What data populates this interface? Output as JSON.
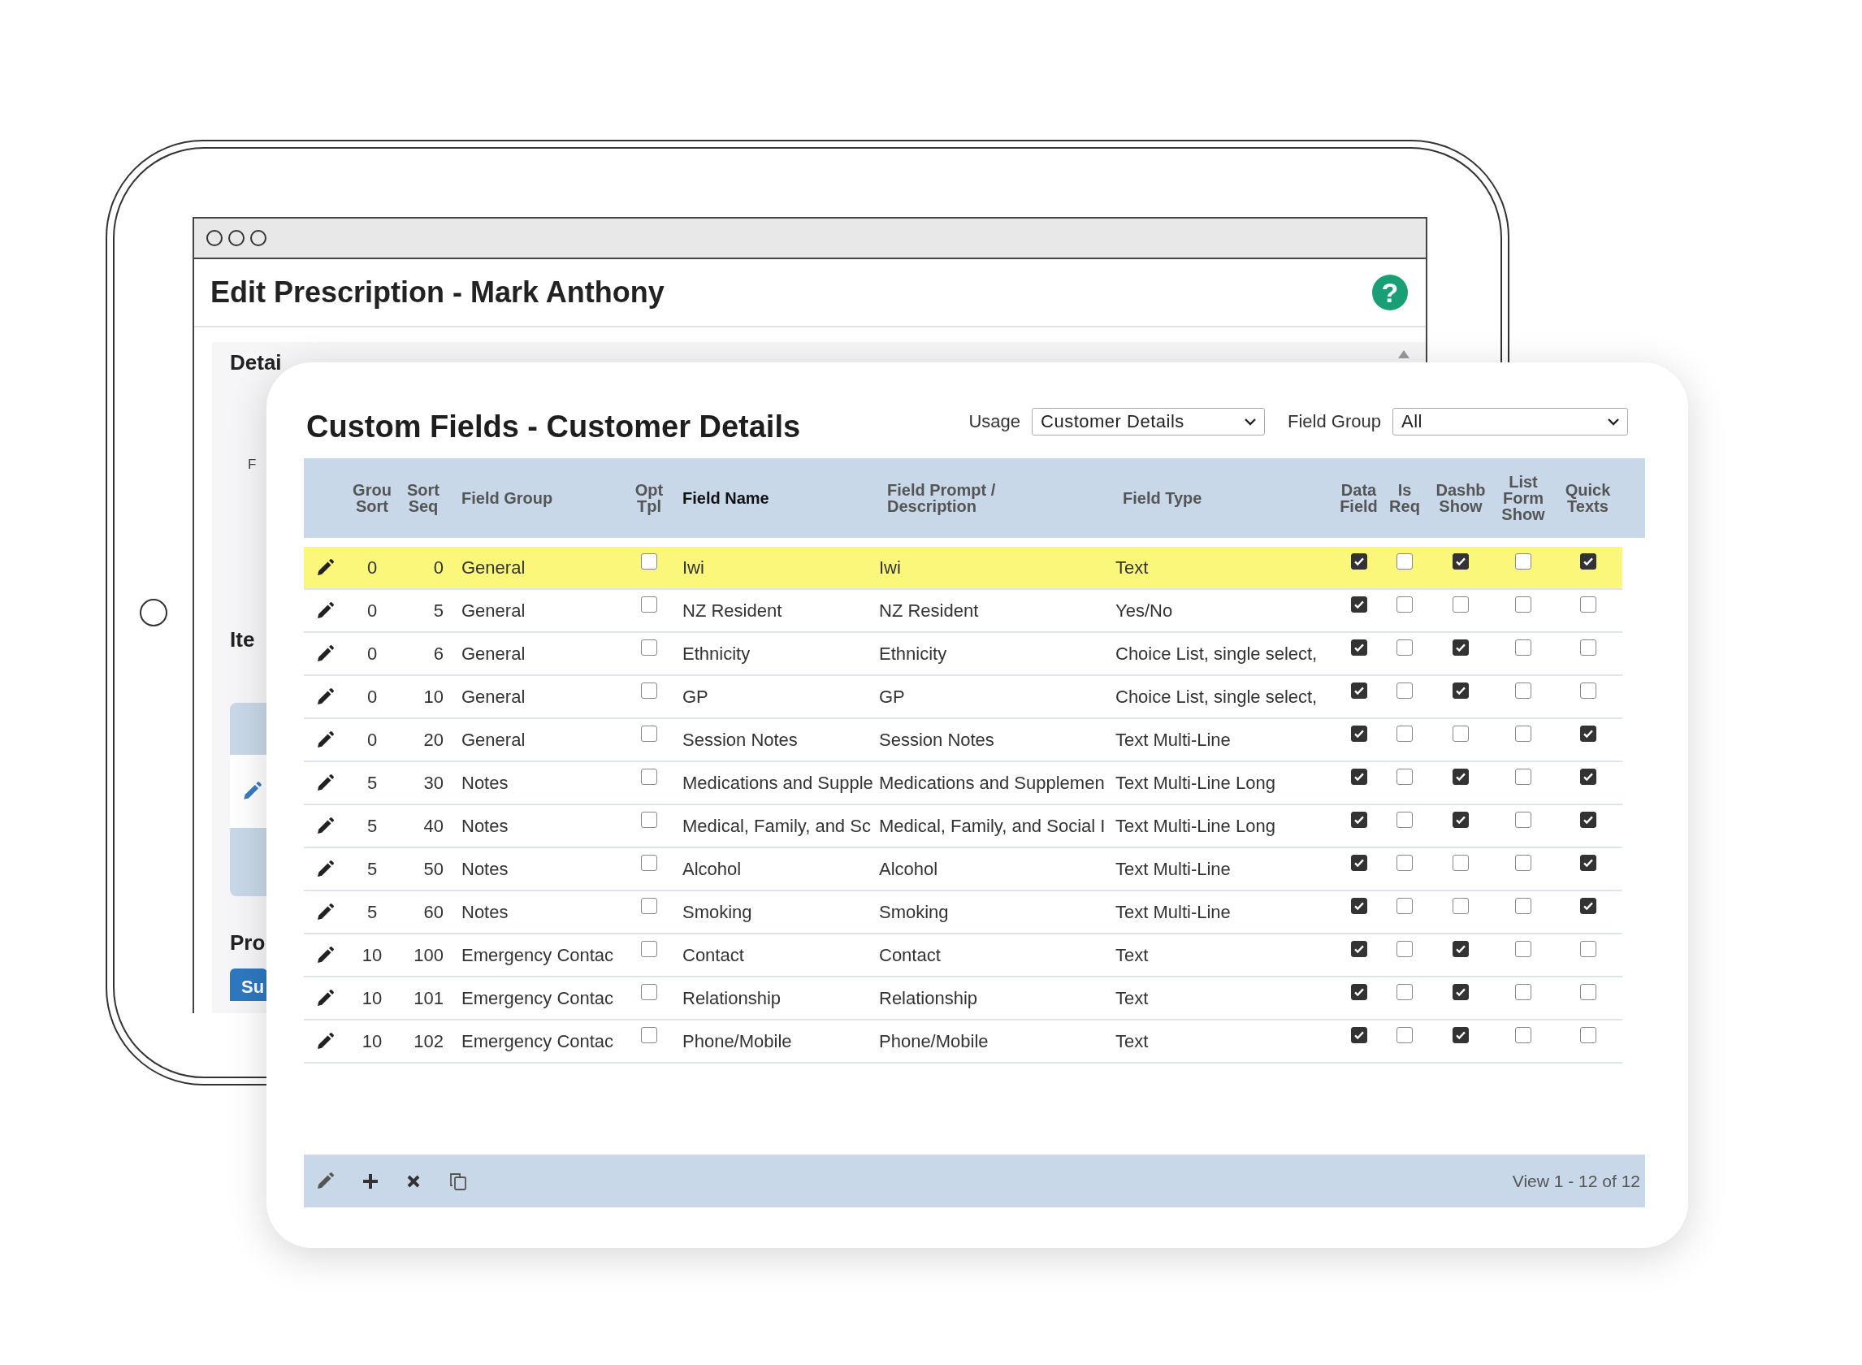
{
  "back_window": {
    "title": "Edit Prescription - Mark Anthony",
    "help_button": "?",
    "details_heading": "Detai",
    "field_label": "F",
    "items_heading": "Ite",
    "pro_heading": "Pro",
    "submit_button": "Su"
  },
  "custom_fields": {
    "title": "Custom Fields - Customer Details",
    "usage": {
      "label": "Usage",
      "value": "Customer Details"
    },
    "field_group_filter": {
      "label": "Field Group",
      "value": "All"
    },
    "columns": [
      {
        "kind": "edit"
      },
      {
        "label": "Grou Sort",
        "kind": "center"
      },
      {
        "label": "Sort Seq",
        "kind": "right"
      },
      {
        "label": "Field Group",
        "kind": "text"
      },
      {
        "label": "Opt Tpl",
        "kind": "check"
      },
      {
        "label": "Field Name",
        "kind": "text"
      },
      {
        "label": "Field Prompt / Description",
        "kind": "text"
      },
      {
        "label": "Field Type",
        "kind": "text"
      },
      {
        "label": "Data Field",
        "kind": "check"
      },
      {
        "label": "Is Req",
        "kind": "check"
      },
      {
        "label": "Dashb Show",
        "kind": "check"
      },
      {
        "label": "List Form Show",
        "kind": "check"
      },
      {
        "label": "Quick Texts",
        "kind": "check"
      }
    ],
    "rows": [
      {
        "selected": true,
        "group_sort": "0",
        "sort_seq": "0",
        "field_group": "General",
        "opt_tpl": false,
        "field_name": "Iwi",
        "field_prompt": "Iwi",
        "field_type": "Text",
        "data_field": true,
        "is_required": false,
        "dashb_show": true,
        "list_form_show": false,
        "quick_texts": true
      },
      {
        "selected": false,
        "group_sort": "0",
        "sort_seq": "5",
        "field_group": "General",
        "opt_tpl": false,
        "field_name": "NZ Resident",
        "field_prompt": "NZ Resident",
        "field_type": "Yes/No",
        "data_field": true,
        "is_required": false,
        "dashb_show": false,
        "list_form_show": false,
        "quick_texts": false
      },
      {
        "selected": false,
        "group_sort": "0",
        "sort_seq": "6",
        "field_group": "General",
        "opt_tpl": false,
        "field_name": "Ethnicity",
        "field_prompt": "Ethnicity",
        "field_type": "Choice List, single select,",
        "data_field": true,
        "is_required": false,
        "dashb_show": true,
        "list_form_show": false,
        "quick_texts": false
      },
      {
        "selected": false,
        "group_sort": "0",
        "sort_seq": "10",
        "field_group": "General",
        "opt_tpl": false,
        "field_name": "GP",
        "field_prompt": "GP",
        "field_type": "Choice List, single select,",
        "data_field": true,
        "is_required": false,
        "dashb_show": true,
        "list_form_show": false,
        "quick_texts": false
      },
      {
        "selected": false,
        "group_sort": "0",
        "sort_seq": "20",
        "field_group": "General",
        "opt_tpl": false,
        "field_name": "Session Notes",
        "field_prompt": "Session Notes",
        "field_type": "Text Multi-Line",
        "data_field": true,
        "is_required": false,
        "dashb_show": false,
        "list_form_show": false,
        "quick_texts": true
      },
      {
        "selected": false,
        "group_sort": "5",
        "sort_seq": "30",
        "field_group": "Notes",
        "opt_tpl": false,
        "field_name": "Medications and Supple",
        "field_prompt": "Medications and Supplemen",
        "field_type": "Text Multi-Line Long",
        "data_field": true,
        "is_required": false,
        "dashb_show": true,
        "list_form_show": false,
        "quick_texts": true
      },
      {
        "selected": false,
        "group_sort": "5",
        "sort_seq": "40",
        "field_group": "Notes",
        "opt_tpl": false,
        "field_name": "Medical, Family, and Sc",
        "field_prompt": "Medical, Family, and Social I",
        "field_type": "Text Multi-Line Long",
        "data_field": true,
        "is_required": false,
        "dashb_show": true,
        "list_form_show": false,
        "quick_texts": true
      },
      {
        "selected": false,
        "group_sort": "5",
        "sort_seq": "50",
        "field_group": "Notes",
        "opt_tpl": false,
        "field_name": "Alcohol",
        "field_prompt": "Alcohol",
        "field_type": "Text Multi-Line",
        "data_field": true,
        "is_required": false,
        "dashb_show": false,
        "list_form_show": false,
        "quick_texts": true
      },
      {
        "selected": false,
        "group_sort": "5",
        "sort_seq": "60",
        "field_group": "Notes",
        "opt_tpl": false,
        "field_name": "Smoking",
        "field_prompt": "Smoking",
        "field_type": "Text Multi-Line",
        "data_field": true,
        "is_required": false,
        "dashb_show": false,
        "list_form_show": false,
        "quick_texts": true
      },
      {
        "selected": false,
        "group_sort": "10",
        "sort_seq": "100",
        "field_group": "Emergency Contac",
        "opt_tpl": false,
        "field_name": "Contact",
        "field_prompt": "Contact",
        "field_type": "Text",
        "data_field": true,
        "is_required": false,
        "dashb_show": true,
        "list_form_show": false,
        "quick_texts": false
      },
      {
        "selected": false,
        "group_sort": "10",
        "sort_seq": "101",
        "field_group": "Emergency Contac",
        "opt_tpl": false,
        "field_name": "Relationship",
        "field_prompt": "Relationship",
        "field_type": "Text",
        "data_field": true,
        "is_required": false,
        "dashb_show": true,
        "list_form_show": false,
        "quick_texts": false
      },
      {
        "selected": false,
        "group_sort": "10",
        "sort_seq": "102",
        "field_group": "Emergency Contac",
        "opt_tpl": false,
        "field_name": "Phone/Mobile",
        "field_prompt": "Phone/Mobile",
        "field_type": "Text",
        "data_field": true,
        "is_required": false,
        "dashb_show": true,
        "list_form_show": false,
        "quick_texts": false
      }
    ],
    "pager": "View 1 - 12 of 12"
  }
}
